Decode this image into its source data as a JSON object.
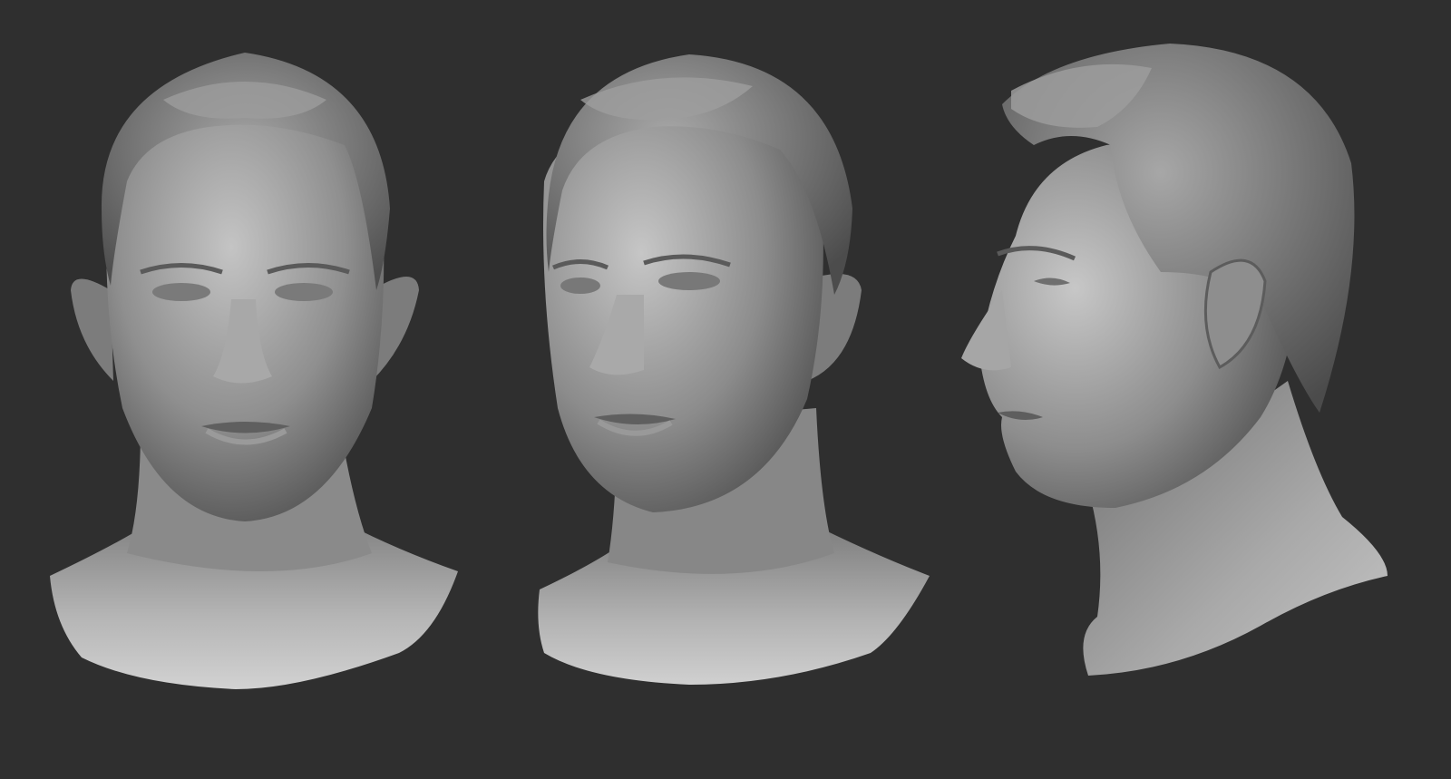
{
  "scene": {
    "background_color": "#2f2f2f",
    "material_color": "#8e8e8e",
    "highlight_color": "#c9c9c9",
    "shadow_color": "#3a3a3a",
    "views": [
      {
        "id": "front",
        "name": "front-view"
      },
      {
        "id": "three_quarter",
        "name": "three-quarter-view"
      },
      {
        "id": "profile",
        "name": "profile-view"
      }
    ]
  }
}
